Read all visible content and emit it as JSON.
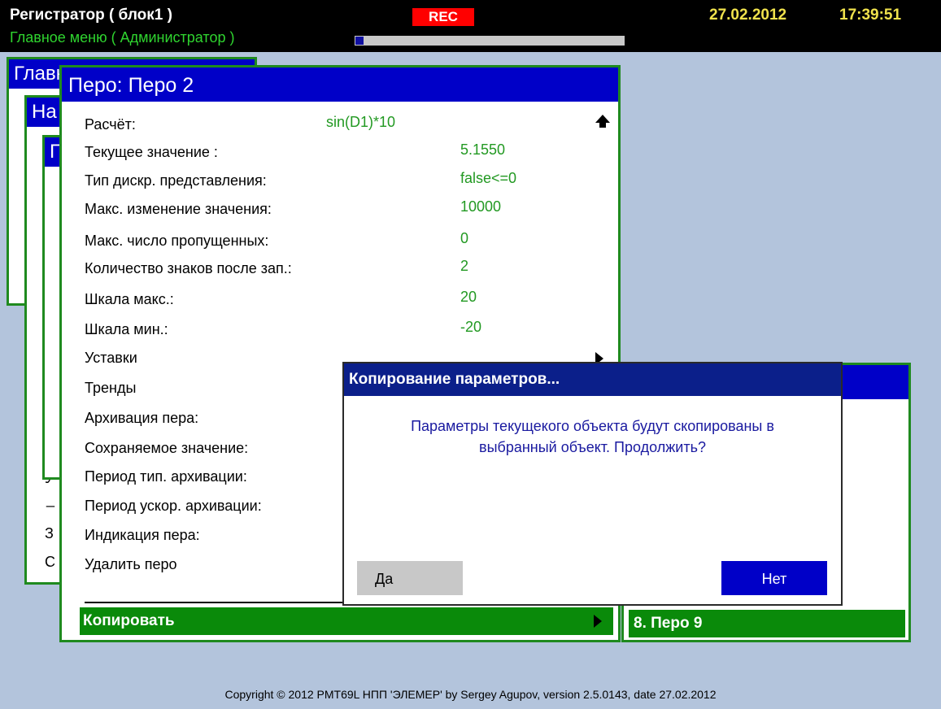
{
  "topbar": {
    "title": "Регистратор ( блок1 )",
    "subtitle": "Главное меню ( Администратор )",
    "rec_label": "REC",
    "date": "27.02.2012",
    "time": "17:39:51",
    "progress_fraction": 0.03
  },
  "background_windows": {
    "w1_title": "Главное меню",
    "w2_title": "На",
    "w3_title": "П",
    "w2_fragments": [
      "У",
      "_",
      "З",
      "С"
    ]
  },
  "main_window": {
    "title": "Перо: Перо 2",
    "rows": [
      {
        "label": "Расчёт:",
        "value": "sin(D1)*10"
      },
      {
        "label": "Текущее значение :",
        "value": "5.1550"
      },
      {
        "label": "Тип дискр. представления:",
        "value": "false<=0"
      },
      {
        "label": "Макс. изменение значения:",
        "value": "10000"
      },
      {
        "label": "Макс. число пропущенных:",
        "value": "0"
      },
      {
        "label": "Количество знаков после зап.:",
        "value": "2"
      },
      {
        "label": "Шкала макс.:",
        "value": "20"
      },
      {
        "label": "Шкала мин.:",
        "value": "-20"
      },
      {
        "label": "Уставки",
        "value": ""
      },
      {
        "label": "Тренды",
        "value": ""
      },
      {
        "label": "Архивация пера:",
        "value": ""
      },
      {
        "label": "Сохраняемое значение:",
        "value": ""
      },
      {
        "label": "Период тип. архивации:",
        "value": ""
      },
      {
        "label": "Период ускор. архивации:",
        "value": ""
      },
      {
        "label": "Индикация пера:",
        "value": ""
      },
      {
        "label": "Удалить перо",
        "value": ""
      }
    ],
    "copy_label": "Копировать"
  },
  "side_list": {
    "selected_item": "8. Перо 9"
  },
  "dialog": {
    "title": "Копирование параметров...",
    "message_line1": "Параметры текущекого объекта будут скопированы в",
    "message_line2": "выбранный объект. Продолжить?",
    "yes_label": "Да",
    "no_label": "Нет"
  },
  "footer": {
    "copyright": "Copyright © 2012 PMT69L НПП 'ЭЛЕМЕР' by Sergey Agupov, version 2.5.0143, date 27.02.2012"
  },
  "colors": {
    "header_blue": "#0000c8",
    "window_border_green": "#1f8a1f",
    "value_green": "#229922",
    "selection_green": "#0a8a0a",
    "rec_red": "#ff0000",
    "clock_yellow": "#f0e24c"
  }
}
